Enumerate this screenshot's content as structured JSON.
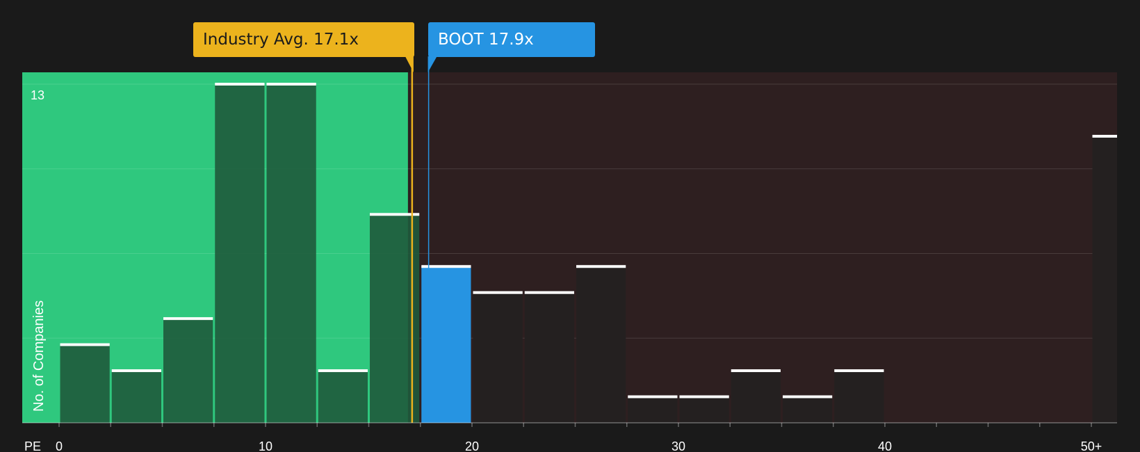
{
  "chart_data": {
    "type": "bar",
    "bins": [
      {
        "x0": 0,
        "x1": 2.5,
        "value": 3
      },
      {
        "x0": 2.5,
        "x1": 5,
        "value": 2
      },
      {
        "x0": 5,
        "x1": 7.5,
        "value": 4
      },
      {
        "x0": 7.5,
        "x1": 10,
        "value": 13
      },
      {
        "x0": 10,
        "x1": 12.5,
        "value": 13
      },
      {
        "x0": 12.5,
        "x1": 15,
        "value": 2
      },
      {
        "x0": 15,
        "x1": 17.5,
        "value": 8
      },
      {
        "x0": 17.5,
        "x1": 20,
        "value": 6
      },
      {
        "x0": 20,
        "x1": 22.5,
        "value": 5
      },
      {
        "x0": 22.5,
        "x1": 25,
        "value": 5
      },
      {
        "x0": 25,
        "x1": 27.5,
        "value": 6
      },
      {
        "x0": 27.5,
        "x1": 30,
        "value": 1
      },
      {
        "x0": 30,
        "x1": 32.5,
        "value": 1
      },
      {
        "x0": 32.5,
        "x1": 35,
        "value": 2
      },
      {
        "x0": 35,
        "x1": 37.5,
        "value": 1
      },
      {
        "x0": 37.5,
        "x1": 40,
        "value": 2
      },
      {
        "x0": 50,
        "x1": 52.5,
        "value": 11
      }
    ],
    "x_ticks": [
      "0",
      "10",
      "20",
      "30",
      "40",
      "50+"
    ],
    "x_tick_values": [
      0,
      10,
      20,
      30,
      40,
      50
    ],
    "xlabel": "PE",
    "ylabel": "No. of Companies",
    "y_tick_label": "13",
    "xlim": [
      0,
      52.5
    ],
    "ylim": [
      0,
      13
    ],
    "grid": true,
    "industry_avg": {
      "label": "Industry Avg. 17.1x",
      "value": 17.1
    },
    "company": {
      "label": "BOOT 17.9x",
      "value": 17.9
    },
    "fair_zone_end": 16.9
  },
  "colors": {
    "background": "#1a1a1a",
    "fair_zone": "#2fc87e",
    "expensive_zone": "#2e1f20",
    "bar_in_fair_zone": "#1f5a3c",
    "bar_default": "#242020",
    "company_bar": "#2694e2",
    "industry_line": "#ecb31d",
    "bar_cap": "#ffffff",
    "text": "#ffffff"
  }
}
